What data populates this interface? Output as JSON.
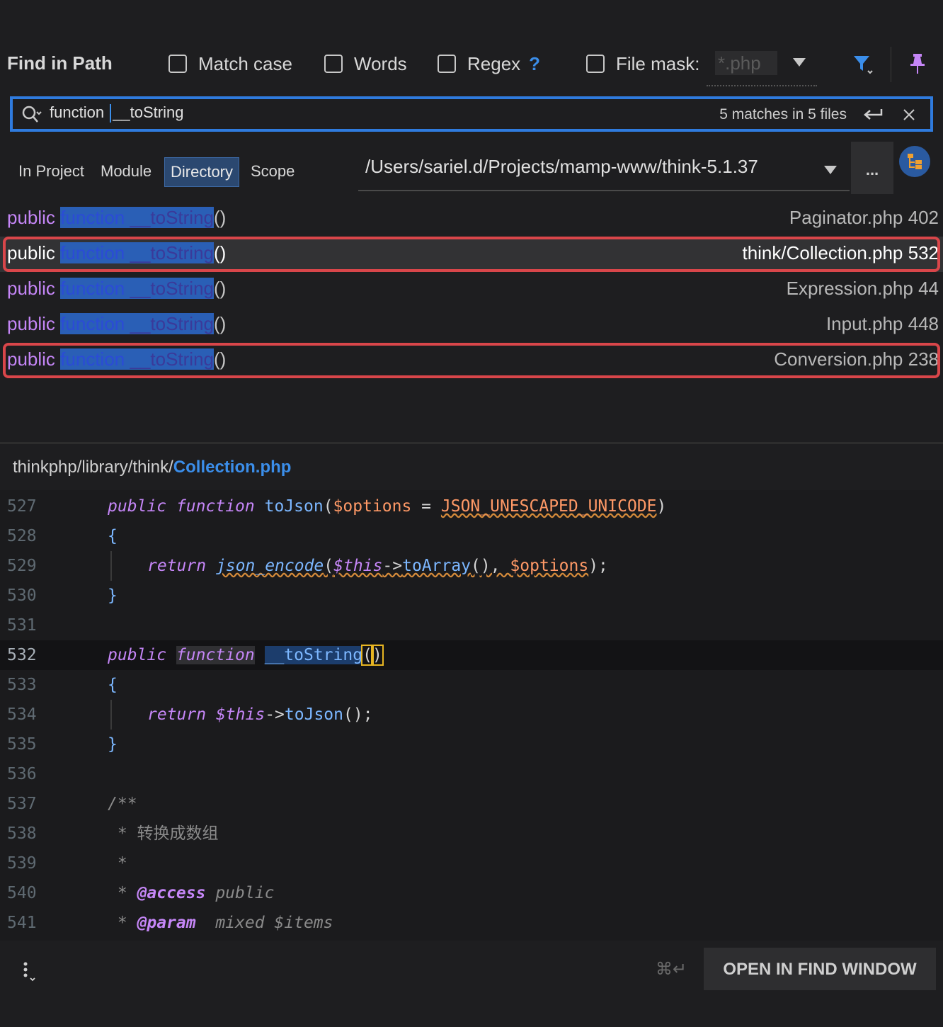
{
  "header": {
    "title": "Find in Path",
    "options": [
      {
        "label": "Match case",
        "checked": false
      },
      {
        "label": "Words",
        "checked": false
      },
      {
        "label": "Regex",
        "checked": false
      },
      {
        "label": "File mask:",
        "checked": false
      }
    ],
    "regex_help": "?",
    "file_mask_value": "*.php",
    "icons": [
      "filter-icon",
      "pin-icon"
    ]
  },
  "search": {
    "query_part1": "function",
    "query_part2": "__toString",
    "match_count": "5 matches in 5 files",
    "icons": [
      "search-icon",
      "enter-icon",
      "close-icon"
    ]
  },
  "scope": {
    "tabs": [
      {
        "label": "In Project",
        "active": false
      },
      {
        "label": "Module",
        "active": false
      },
      {
        "label": "Directory",
        "active": true
      },
      {
        "label": "Scope",
        "active": false
      }
    ],
    "directory": "/Users/sariel.d/Projects/mamp-www/think-5.1.37",
    "browse_label": "..."
  },
  "results": [
    {
      "keyword": "public",
      "fn": "function",
      "name": "__toString",
      "paren": "()",
      "file": "Paginator.php 402",
      "selected": false,
      "highlighted": false
    },
    {
      "keyword": "public",
      "fn": "function",
      "name": "__toString",
      "paren": "()",
      "file": "think/Collection.php 532",
      "selected": true,
      "highlighted": true
    },
    {
      "keyword": "public",
      "fn": "function",
      "name": "__toString",
      "paren": "()",
      "file": "Expression.php 44",
      "selected": false,
      "highlighted": false
    },
    {
      "keyword": "public",
      "fn": "function",
      "name": "__toString",
      "paren": "()",
      "file": "Input.php 448",
      "selected": false,
      "highlighted": false
    },
    {
      "keyword": "public",
      "fn": "function",
      "name": "__toString",
      "paren": "()",
      "file": "Conversion.php 238",
      "selected": false,
      "highlighted": true
    }
  ],
  "preview": {
    "path_prefix": "thinkphp/library/think/",
    "file_name": "Collection.php",
    "lines": {
      "l527": {
        "num": "527",
        "kw1": "public",
        "kw2": "function",
        "fn": "toJson",
        "p1": "(",
        "var": "$options",
        "eq": " = ",
        "const": "JSON_UNESCAPED_UNICODE",
        "p2": ")"
      },
      "l528": {
        "num": "528",
        "text": "{"
      },
      "l529": {
        "num": "529",
        "kw": "return",
        "fn": "json_encode",
        "p1": "(",
        "this": "$this",
        "arrow": "->",
        "m": "toArray",
        "p2": "(), ",
        "var": "$options",
        "p3": ");"
      },
      "l530": {
        "num": "530",
        "text": "}"
      },
      "l531": {
        "num": "531"
      },
      "l532": {
        "num": "532",
        "kw1": "public",
        "kw2": "function",
        "fn": "__toString",
        "p1": "(",
        "p2": ")"
      },
      "l533": {
        "num": "533",
        "text": "{"
      },
      "l534": {
        "num": "534",
        "kw": "return",
        "this": "$this",
        "arrow": "->",
        "m": "toJson",
        "p": "();"
      },
      "l535": {
        "num": "535",
        "text": "}"
      },
      "l536": {
        "num": "536"
      },
      "l537": {
        "num": "537",
        "text": "/**"
      },
      "l538": {
        "num": "538",
        "text": " * 转换成数组"
      },
      "l539": {
        "num": "539",
        "text": " *"
      },
      "l540": {
        "num": "540",
        "star": " * ",
        "tag": "@access",
        "rest": " public"
      },
      "l541": {
        "num": "541",
        "star": " * ",
        "tag": "@param",
        "rest": "  mixed $items"
      }
    }
  },
  "footer": {
    "shortcut": "⌘↵",
    "open_button": "OPEN IN FIND WINDOW"
  }
}
